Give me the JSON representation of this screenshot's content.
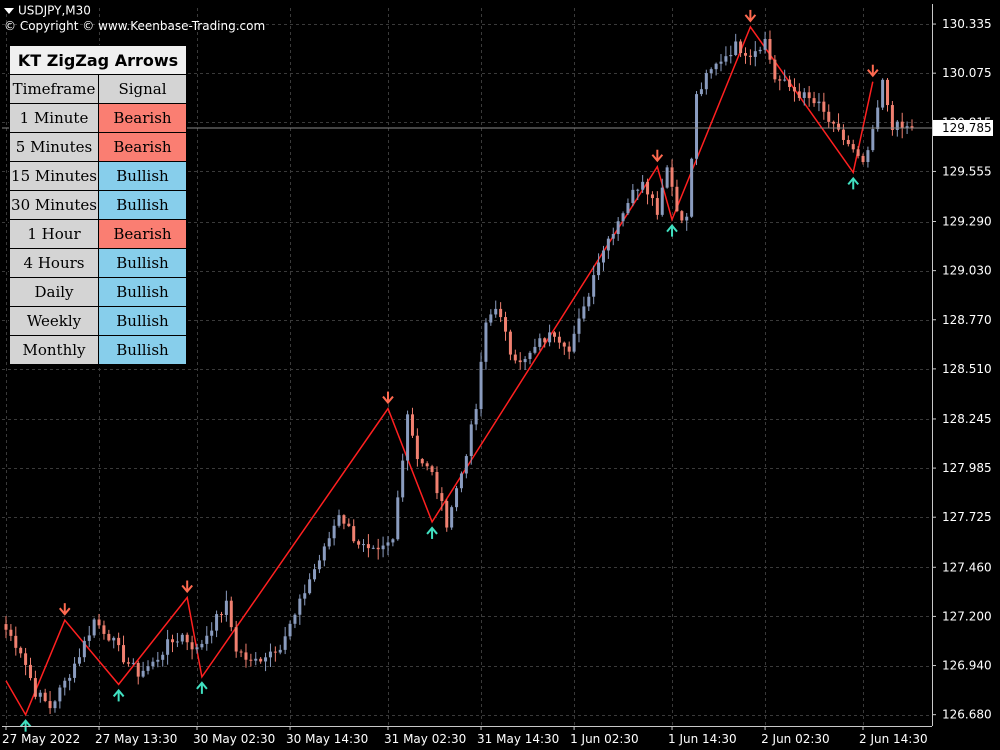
{
  "window": {
    "title": "USDJPY,M30",
    "subtitle": "© Copyright © www.Keenbase-Trading.com"
  },
  "indicator": {
    "title": "KT ZigZag Arrows",
    "header_timeframe": "Timeframe",
    "header_signal": "Signal",
    "rows": [
      {
        "timeframe": "1 Minute",
        "signal": "Bearish"
      },
      {
        "timeframe": "5 Minutes",
        "signal": "Bearish"
      },
      {
        "timeframe": "15 Minutes",
        "signal": "Bullish"
      },
      {
        "timeframe": "30 Minutes",
        "signal": "Bullish"
      },
      {
        "timeframe": "1 Hour",
        "signal": "Bearish"
      },
      {
        "timeframe": "4 Hours",
        "signal": "Bullish"
      },
      {
        "timeframe": "Daily",
        "signal": "Bullish"
      },
      {
        "timeframe": "Weekly",
        "signal": "Bullish"
      },
      {
        "timeframe": "Monthly",
        "signal": "Bullish"
      }
    ]
  },
  "colors": {
    "background": "#000000",
    "grid": "#3a3a3a",
    "bull_candle": "#8a9cbf",
    "bear_candle": "#f08070",
    "zigzag": "#ff2020",
    "arrow_up": "#40e0c0",
    "arrow_down": "#ff6a50"
  },
  "chart_data": {
    "type": "candlestick",
    "symbol": "USDJPY",
    "timeframe": "M30",
    "ylim": [
      126.62,
      130.42
    ],
    "current_price": 129.785,
    "y_ticks": [
      "130.335",
      "130.075",
      "129.815",
      "129.555",
      "129.290",
      "129.030",
      "128.770",
      "128.510",
      "128.245",
      "127.985",
      "127.725",
      "127.460",
      "127.200",
      "126.940",
      "126.680"
    ],
    "x_ticks": [
      "27 May 2022",
      "27 May 13:30",
      "30 May 02:30",
      "30 May 14:30",
      "31 May 02:30",
      "31 May 14:30",
      "1 Jun 02:30",
      "1 Jun 14:30",
      "2 Jun 02:30",
      "2 Jun 14:30"
    ],
    "candle_count": 186,
    "close_path": [
      [
        0,
        127.13
      ],
      [
        3,
        127.02
      ],
      [
        6,
        126.8
      ],
      [
        9,
        126.72
      ],
      [
        12,
        126.85
      ],
      [
        15,
        127.0
      ],
      [
        18,
        127.18
      ],
      [
        21,
        127.1
      ],
      [
        24,
        126.98
      ],
      [
        27,
        126.9
      ],
      [
        30,
        126.95
      ],
      [
        33,
        127.05
      ],
      [
        36,
        127.1
      ],
      [
        39,
        127.02
      ],
      [
        42,
        127.15
      ],
      [
        45,
        127.26
      ],
      [
        47,
        127.03
      ],
      [
        50,
        126.95
      ],
      [
        53,
        127.0
      ],
      [
        56,
        127.05
      ],
      [
        59,
        127.2
      ],
      [
        62,
        127.4
      ],
      [
        65,
        127.55
      ],
      [
        68,
        127.75
      ],
      [
        71,
        127.62
      ],
      [
        74,
        127.54
      ],
      [
        76,
        127.53
      ],
      [
        79,
        127.6
      ],
      [
        82,
        128.28
      ],
      [
        84,
        128.05
      ],
      [
        87,
        127.95
      ],
      [
        90,
        127.7
      ],
      [
        93,
        127.96
      ],
      [
        96,
        128.3
      ],
      [
        98,
        128.75
      ],
      [
        100,
        128.85
      ],
      [
        103,
        128.6
      ],
      [
        106,
        128.55
      ],
      [
        109,
        128.65
      ],
      [
        112,
        128.7
      ],
      [
        115,
        128.63
      ],
      [
        118,
        128.82
      ],
      [
        121,
        129.1
      ],
      [
        124,
        129.25
      ],
      [
        127,
        129.4
      ],
      [
        130,
        129.52
      ],
      [
        133,
        129.35
      ],
      [
        135,
        129.6
      ],
      [
        137,
        129.35
      ],
      [
        139,
        129.3
      ],
      [
        141,
        129.95
      ],
      [
        143,
        130.05
      ],
      [
        146,
        130.15
      ],
      [
        149,
        130.22
      ],
      [
        152,
        130.18
      ],
      [
        155,
        130.25
      ],
      [
        157,
        130.05
      ],
      [
        160,
        130.0
      ],
      [
        163,
        129.95
      ],
      [
        166,
        129.9
      ],
      [
        169,
        129.78
      ],
      [
        172,
        129.7
      ],
      [
        175,
        129.58
      ],
      [
        177,
        129.75
      ],
      [
        179,
        130.02
      ],
      [
        181,
        129.8
      ],
      [
        183,
        129.78
      ],
      [
        185,
        129.79
      ]
    ]
  },
  "zigzag": {
    "points": [
      [
        0,
        126.86
      ],
      [
        4,
        126.68
      ],
      [
        12,
        127.18
      ],
      [
        23,
        126.84
      ],
      [
        37,
        127.3
      ],
      [
        40,
        126.88
      ],
      [
        78,
        128.3
      ],
      [
        87,
        127.7
      ],
      [
        133,
        129.58
      ],
      [
        136,
        129.3
      ],
      [
        152,
        130.32
      ],
      [
        173,
        129.55
      ],
      [
        177,
        130.03
      ]
    ],
    "arrows": [
      {
        "index": 4,
        "price": 126.68,
        "dir": "up"
      },
      {
        "index": 12,
        "price": 127.18,
        "dir": "down"
      },
      {
        "index": 23,
        "price": 126.84,
        "dir": "up"
      },
      {
        "index": 37,
        "price": 127.3,
        "dir": "down"
      },
      {
        "index": 40,
        "price": 126.88,
        "dir": "up"
      },
      {
        "index": 78,
        "price": 128.3,
        "dir": "down"
      },
      {
        "index": 87,
        "price": 127.7,
        "dir": "up"
      },
      {
        "index": 133,
        "price": 129.58,
        "dir": "down"
      },
      {
        "index": 136,
        "price": 129.3,
        "dir": "up"
      },
      {
        "index": 152,
        "price": 130.32,
        "dir": "down"
      },
      {
        "index": 173,
        "price": 129.55,
        "dir": "up"
      },
      {
        "index": 177,
        "price": 130.03,
        "dir": "down"
      }
    ]
  }
}
